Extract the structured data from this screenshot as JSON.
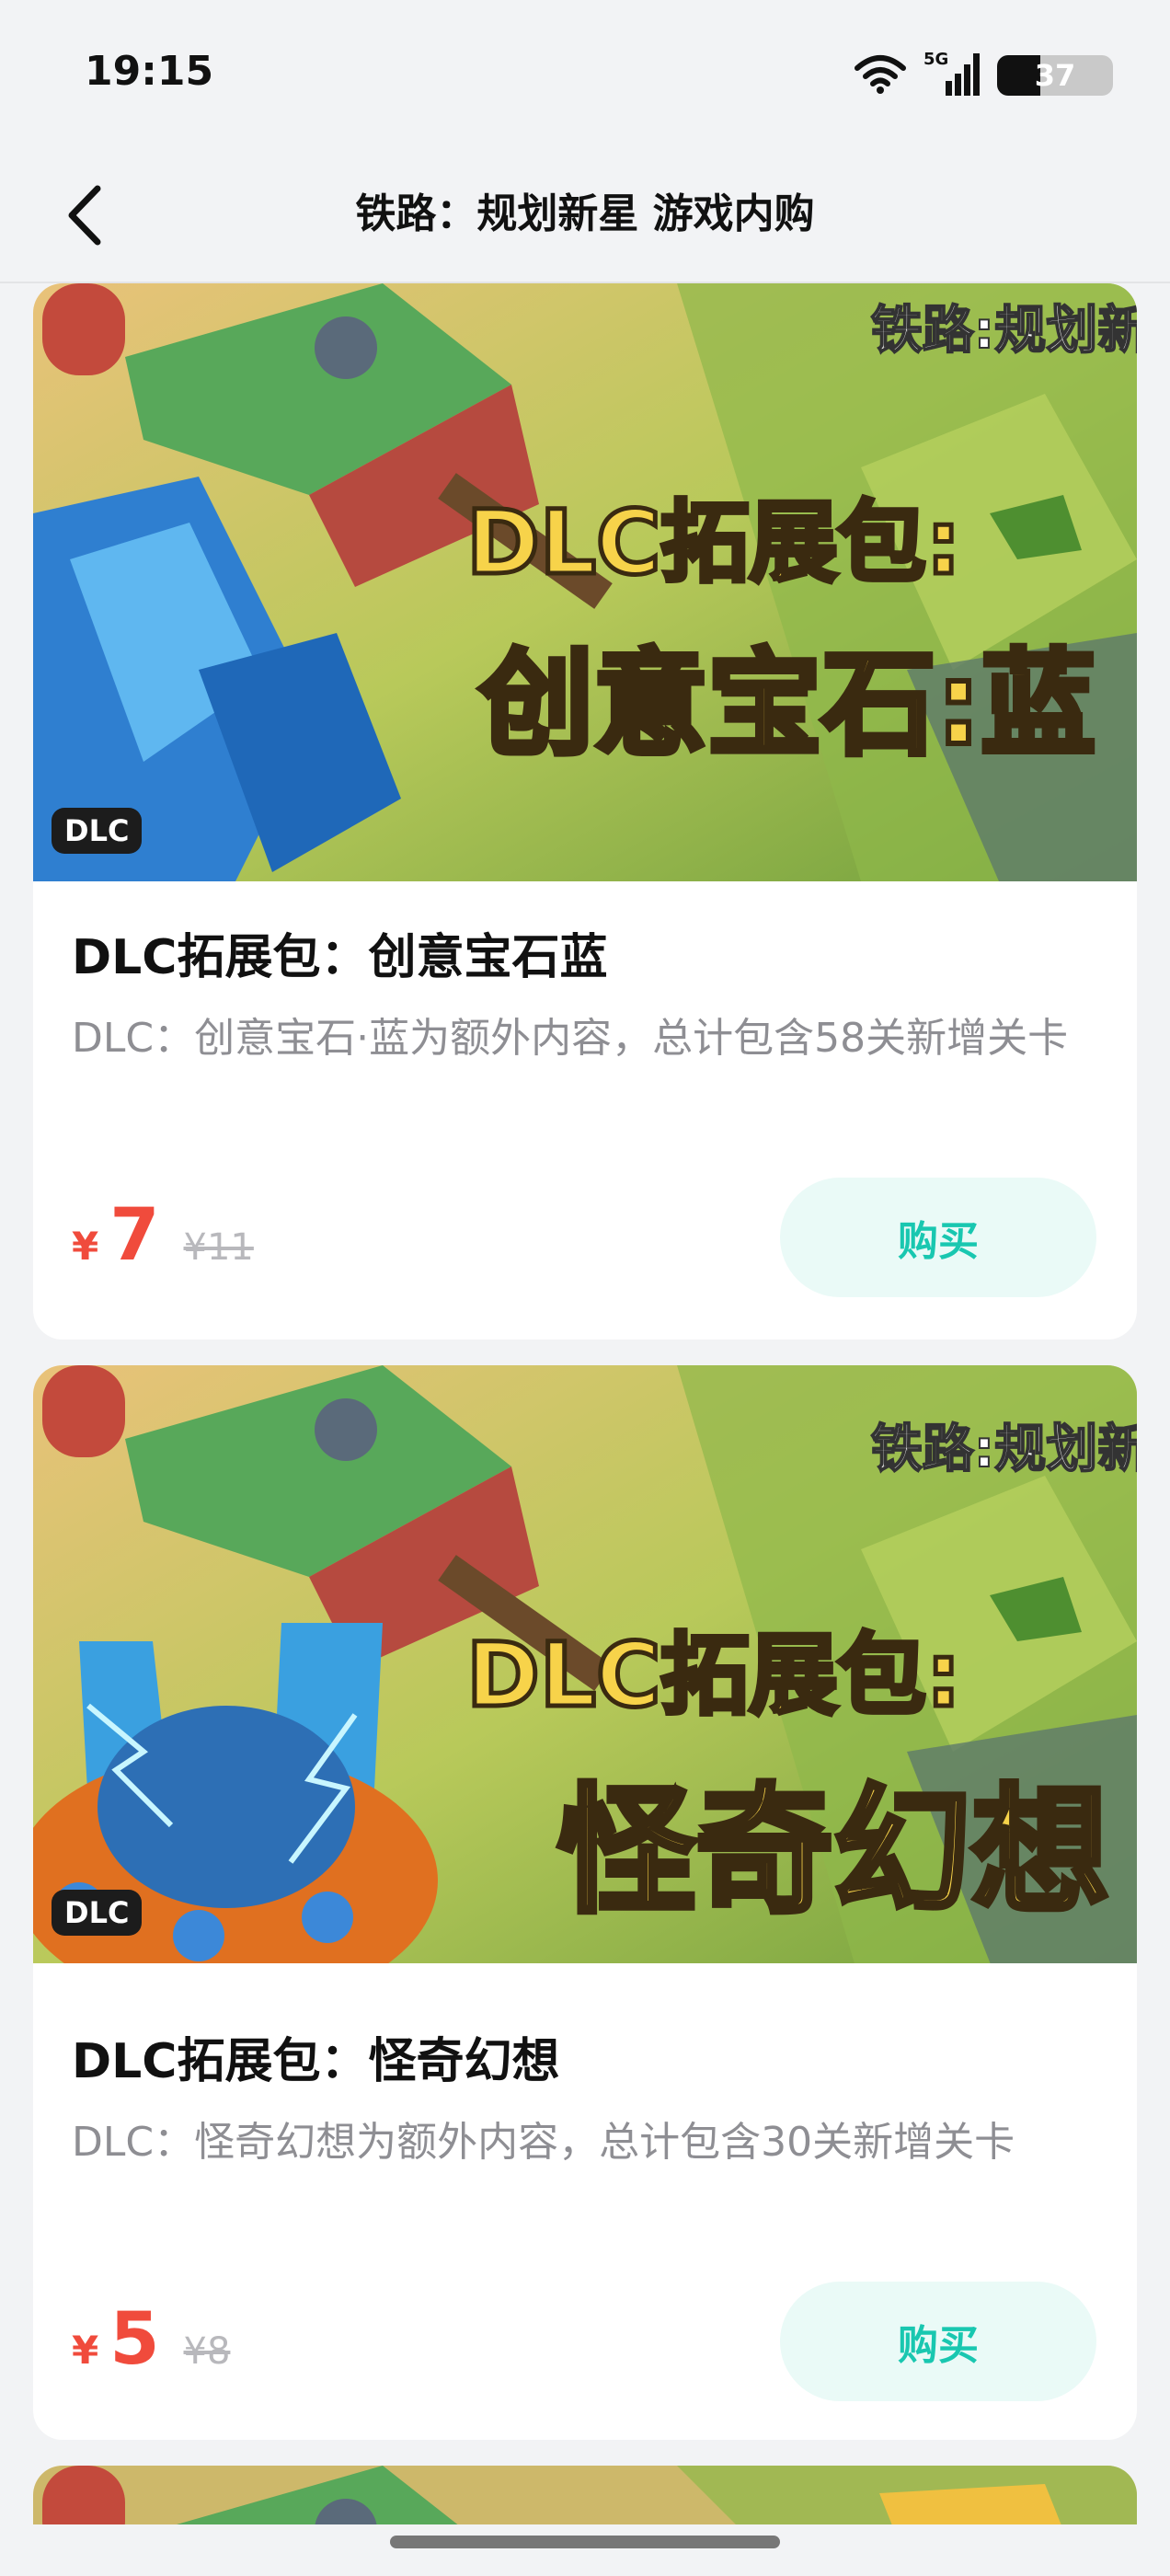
{
  "status_bar": {
    "time": "19:15",
    "network": "5G",
    "battery": "37",
    "battery_level": 0.37
  },
  "nav": {
    "title": "铁路：规划新星 游戏内购"
  },
  "colors": {
    "accent": "#19c7b0",
    "price": "#f04b3c",
    "background": "#f2f3f5"
  },
  "products": [
    {
      "banner": {
        "logo": "铁路:规划新星",
        "line1": "DLC拓展包:",
        "line2": "创意宝石:蓝",
        "badge": "DLC"
      },
      "title": "DLC拓展包：创意宝石蓝",
      "description": "DLC：创意宝石·蓝为额外内容，总计包含58关新增关卡",
      "currency": "¥",
      "price": "7",
      "original_price": "¥11",
      "buy_label": "购买"
    },
    {
      "banner": {
        "logo": "铁路:规划新星",
        "line1": "DLC拓展包:",
        "line2": "怪奇幻想",
        "badge": "DLC"
      },
      "title": "DLC拓展包：怪奇幻想",
      "description": "DLC：怪奇幻想为额外内容，总计包含30关新增关卡",
      "currency": "¥",
      "price": "5",
      "original_price": "¥8",
      "buy_label": "购买"
    }
  ]
}
